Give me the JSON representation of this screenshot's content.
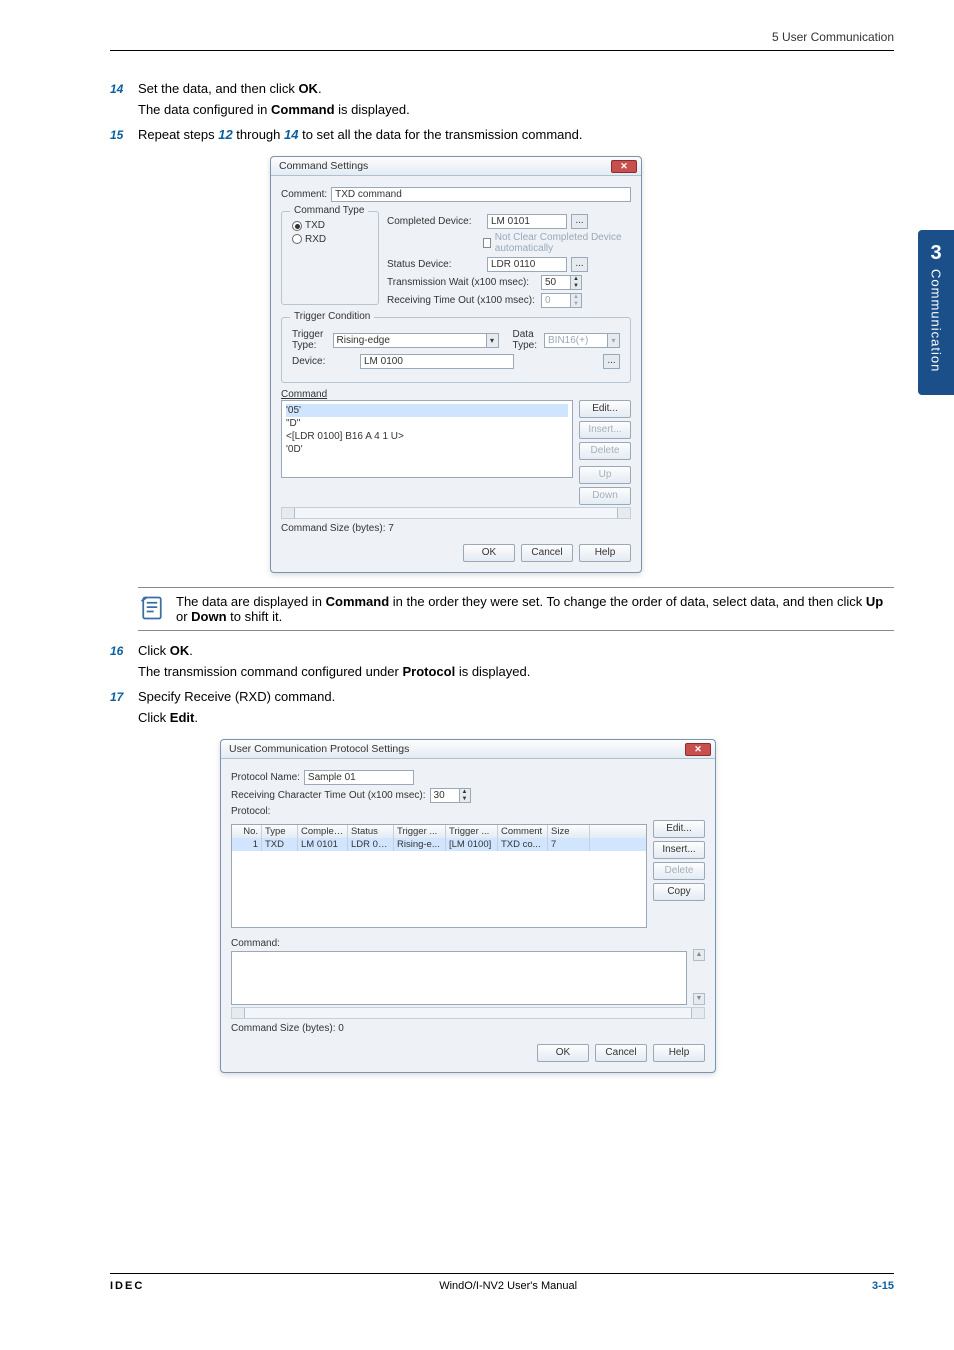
{
  "header": {
    "section": "5 User Communication"
  },
  "sideTab": {
    "number": "3",
    "label": "Communication"
  },
  "steps": {
    "s14": {
      "num": "14",
      "text_pre": "Set the data, and then click ",
      "text_bold": "OK",
      "text_post": ".",
      "sub_pre": "The data configured in ",
      "sub_bold": "Command",
      "sub_post": " is displayed."
    },
    "s15": {
      "num": "15",
      "text_pre": "Repeat steps ",
      "ref1": "12",
      "text_mid": " through ",
      "ref2": "14",
      "text_post": " to set all the data for the transmission command."
    },
    "s16": {
      "num": "16",
      "text_pre": "Click ",
      "text_bold": "OK",
      "text_post": ".",
      "sub_pre": "The transmission command configured under ",
      "sub_bold": "Protocol",
      "sub_post": " is displayed."
    },
    "s17": {
      "num": "17",
      "line1": "Specify Receive (RXD) command.",
      "line2_pre": "Click ",
      "line2_bold": "Edit",
      "line2_post": "."
    }
  },
  "note": {
    "pre": "The data are displayed in ",
    "b1": "Command",
    "mid1": " in the order they were set. To change the order of data, select data, and then click ",
    "b2": "Up",
    "mid2": " or ",
    "b3": "Down",
    "post": " to shift it."
  },
  "cmdDialog": {
    "title": "Command Settings",
    "comment_label": "Comment:",
    "comment_value": "TXD command",
    "ctype_group": "Command Type",
    "txd": "TXD",
    "rxd": "RXD",
    "completed_label": "Completed Device:",
    "completed_value": "LM 0101",
    "notclear": "Not Clear Completed Device automatically",
    "status_label": "Status Device:",
    "status_value": "LDR 0110",
    "txwait_label": "Transmission Wait (x100 msec):",
    "txwait_value": "50",
    "rxtimeout_label": "Receiving Time Out (x100 msec):",
    "rxtimeout_value": "0",
    "trigger_group": "Trigger Condition",
    "triggertype_label": "Trigger Type:",
    "triggertype_value": "Rising-edge",
    "datatype_label": "Data Type:",
    "datatype_value": "BIN16(+)",
    "device_label": "Device:",
    "device_value": "LM 0100",
    "command_group": "Command",
    "line1": "'05'",
    "line2": "\"D\"",
    "line3": "<[LDR 0100] B16 A 4 1 U>",
    "line4": "'0D'",
    "edit": "Edit...",
    "insert": "Insert...",
    "delete": "Delete",
    "up": "Up",
    "down": "Down",
    "cmdsize": "Command Size (bytes):  7",
    "ok": "OK",
    "cancel": "Cancel",
    "help": "Help"
  },
  "ucpDialog": {
    "title": "User Communication Protocol Settings",
    "pname_label": "Protocol Name:",
    "pname_value": "Sample 01",
    "rcto_label": "Receiving Character Time Out (x100 msec):",
    "rcto_value": "30",
    "protocol_label": "Protocol:",
    "headers": {
      "no": "No.",
      "type": "Type",
      "compl": "Complet...",
      "status": "Status",
      "trig": "Trigger ...",
      "trigg": "Trigger ...",
      "comm": "Comment",
      "size": "Size"
    },
    "row": {
      "no": "1",
      "type": "TXD",
      "compl": "LM 0101",
      "status": "LDR 01...",
      "trig": "Rising-e...",
      "trigg": "[LM 0100]",
      "comm": "TXD co...",
      "size": "7"
    },
    "edit": "Edit...",
    "insert": "Insert...",
    "delete": "Delete",
    "copy": "Copy",
    "command_label": "Command:",
    "cmdsize": "Command Size (bytes):  0",
    "ok": "OK",
    "cancel": "Cancel",
    "help": "Help"
  },
  "footer": {
    "brand": "IDEC",
    "center": "WindO/I-NV2 User's Manual",
    "page": "3-15"
  }
}
